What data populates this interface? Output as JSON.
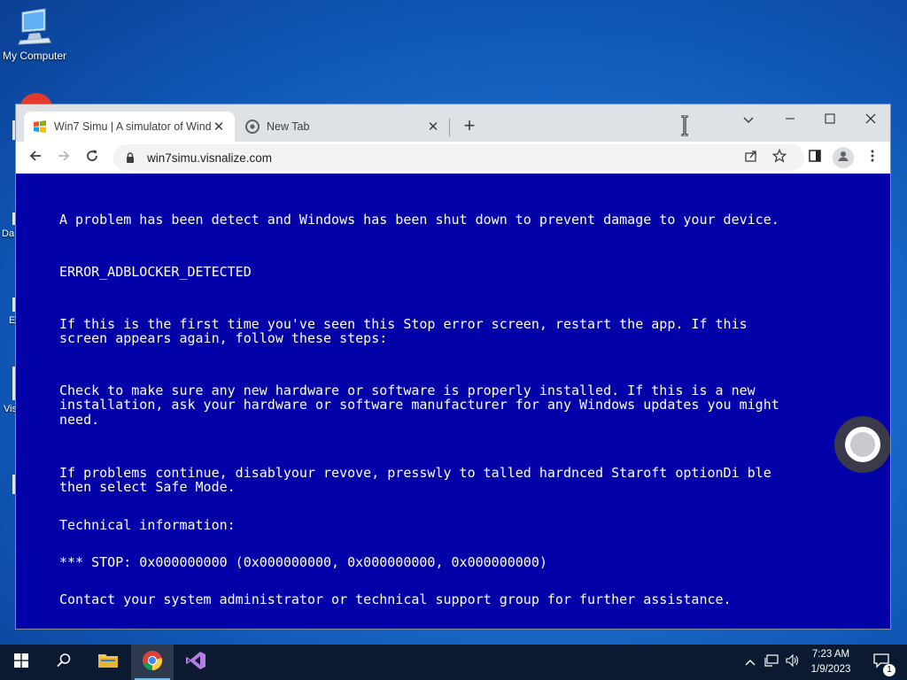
{
  "desktop": {
    "icon_label": "My Computer",
    "fragments": [
      "Da",
      "E",
      "Vis"
    ]
  },
  "browser": {
    "tabs": [
      {
        "title": "Win7 Simu | A simulator of Wind",
        "active": true
      },
      {
        "title": "New Tab",
        "active": false
      }
    ],
    "url": "win7simu.visnalize.com"
  },
  "bsod": {
    "line1": "A problem has been detect and Windows has been shut down to prevent damage to your device.",
    "error_code": "ERROR_ADBLOCKER_DETECTED",
    "para1": "If this is the first time you've seen this Stop error screen, restart the app. If this\nscreen appears again, follow these steps:",
    "para2": "Check to make sure any new hardware or software is properly installed. If this is a new\ninstallation, ask your hardware or software manufacturer for any Windows updates you might\nneed.",
    "para3": "If problems continue, disablyour revove, presswly to talled hardnced Staroft optionDi ble\nthen select Safe Mode.",
    "tech_header": "Technical information:",
    "stop_line": "*** STOP: 0x000000000 (0x000000000, 0x000000000, 0x000000000)",
    "contact": "Contact your system administrator or technical support group for further assistance."
  },
  "taskbar": {
    "time": "7:23 AM",
    "date": "1/9/2023",
    "notification_count": "1"
  },
  "colors": {
    "bsod_bg": "#0202a8",
    "taskbar_bg": "#0b1a30",
    "accent": "#76b9ed"
  }
}
